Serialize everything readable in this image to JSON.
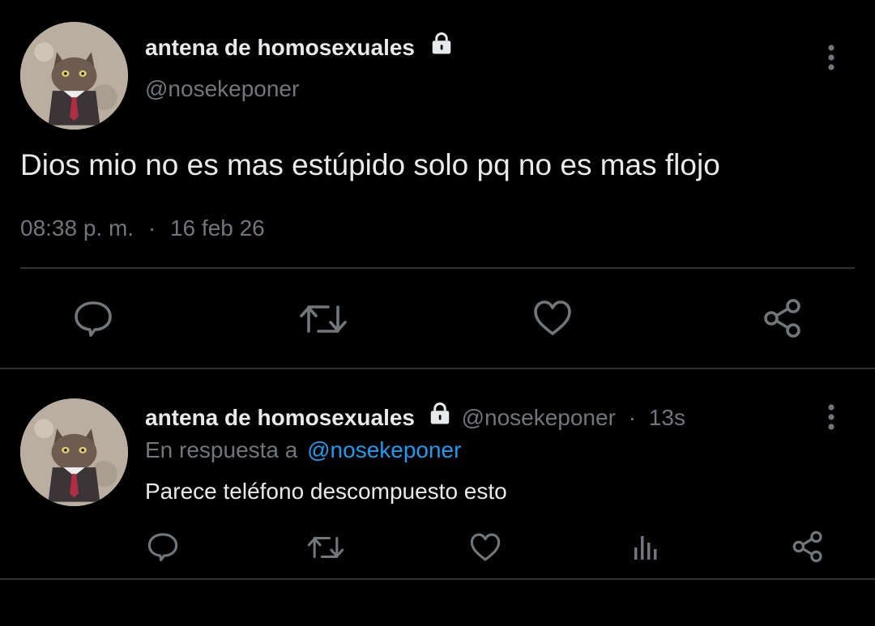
{
  "main_tweet": {
    "display_name": "antena de homosexuales",
    "handle": "@nosekeponer",
    "text": "Dios mio no es mas estúpido solo pq no es mas flojo",
    "time": "08:38 p. m.",
    "separator": "·",
    "date": "16 feb 26",
    "more_icon": "more-vertical-icon",
    "lock_icon": "lock-icon",
    "actions": [
      "reply-icon",
      "retweet-icon",
      "like-icon",
      "share-icon"
    ]
  },
  "reply_tweet": {
    "display_name": "antena de homosexuales",
    "handle": "@nosekeponer",
    "separator": "·",
    "age": "13s",
    "reply_prefix": "En respuesta a",
    "reply_to": "@nosekeponer",
    "text": "Parece teléfono descompuesto esto",
    "more_icon": "more-vertical-icon",
    "actions": [
      "reply-icon",
      "retweet-icon",
      "like-icon",
      "analytics-icon",
      "share-icon"
    ]
  },
  "colors": {
    "background": "#000000",
    "text": "#e7e9ea",
    "secondary": "#71767b",
    "link": "#1d9bf0",
    "divider": "#2f3336"
  }
}
